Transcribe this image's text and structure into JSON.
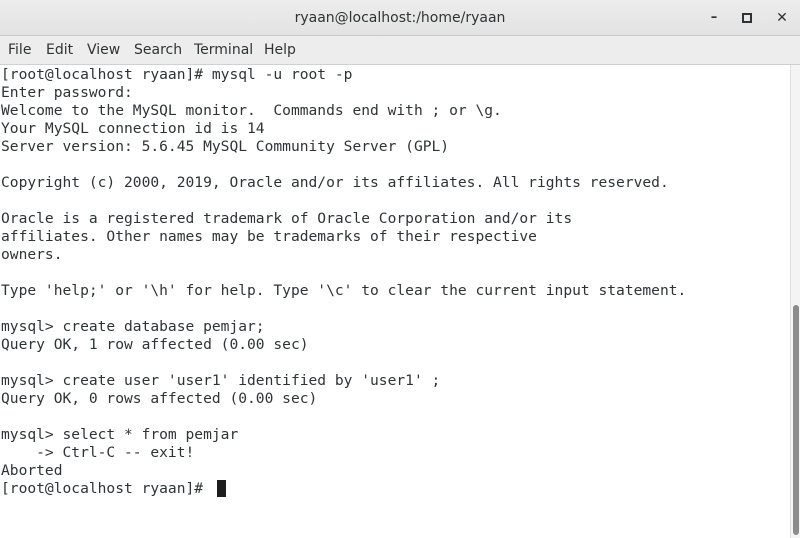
{
  "window": {
    "title": "ryaan@localhost:/home/ryaan",
    "minimize_glyph": "–",
    "close_glyph": "✕"
  },
  "menu": {
    "items": [
      "File",
      "Edit",
      "View",
      "Search",
      "Terminal",
      "Help"
    ]
  },
  "terminal": {
    "lines": [
      "[root@localhost ryaan]# mysql -u root -p",
      "Enter password:",
      "Welcome to the MySQL monitor.  Commands end with ; or \\g.",
      "Your MySQL connection id is 14",
      "Server version: 5.6.45 MySQL Community Server (GPL)",
      "",
      "Copyright (c) 2000, 2019, Oracle and/or its affiliates. All rights reserved.",
      "",
      "Oracle is a registered trademark of Oracle Corporation and/or its",
      "affiliates. Other names may be trademarks of their respective",
      "owners.",
      "",
      "Type 'help;' or '\\h' for help. Type '\\c' to clear the current input statement.",
      "",
      "mysql> create database pemjar;",
      "Query OK, 1 row affected (0.00 sec)",
      "",
      "mysql> create user 'user1' identified by 'user1' ;",
      "Query OK, 0 rows affected (0.00 sec)",
      "",
      "mysql> select * from pemjar",
      "    -> Ctrl-C -- exit!",
      "Aborted",
      "[root@localhost ryaan]# "
    ]
  },
  "colors": {
    "text": "#2e3436",
    "titlebar": "#e6e6e6",
    "menubar": "#ededed",
    "terminal_bg": "#ffffff"
  }
}
